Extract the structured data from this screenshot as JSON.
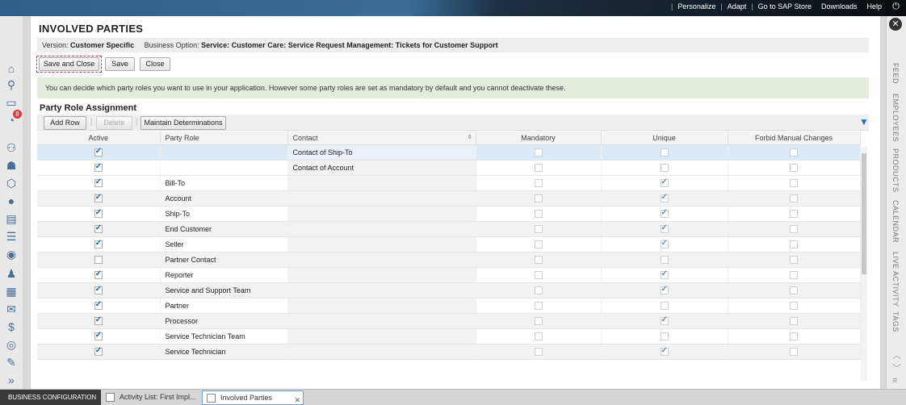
{
  "topbar": {
    "links": [
      "Personalize",
      "Adapt",
      "Go to SAP Store",
      "Downloads",
      "Help"
    ]
  },
  "left_rail": {
    "icons": [
      "home-icon",
      "search-icon",
      "chat-icon",
      "alert-icon",
      "org-chart-icon",
      "hierarchy-icon",
      "package-icon",
      "circle-icon",
      "report-icon",
      "list-icon",
      "person-icon",
      "people-list-icon",
      "building-icon",
      "mail-icon",
      "login-dollar-icon",
      "coin-icon",
      "user-edit-icon",
      "expand-icon"
    ],
    "alert_count": "8"
  },
  "right_rail": {
    "items": [
      "FEED",
      "EMPLOYEES",
      "PRODUCTS",
      "CALENDAR",
      "LIVE ACTIVITY",
      "TAGS"
    ]
  },
  "main": {
    "title": "INVOLVED PARTIES",
    "info": {
      "version_label": "Version:",
      "version_value": "Customer Specific",
      "option_label": "Business Option:",
      "option_value": "Service: Customer Care: Service Request Management: Tickets for Customer Support"
    },
    "buttons": {
      "save_close": "Save and Close",
      "save": "Save",
      "close": "Close"
    },
    "notice": "You can decide which party roles you want to use in your application. However some party roles are set as mandatory by default and you cannot deactivate these.",
    "section_title": "Party Role Assignment",
    "toolbar": {
      "add_row": "Add Row",
      "delete": "Delete",
      "maintain": "Maintain Determinations"
    },
    "table": {
      "headers": [
        "Active",
        "Party Role",
        "Contact",
        "Mandatory",
        "Unique",
        "Forbid Manual Changes"
      ],
      "rows": [
        {
          "active": true,
          "role": "",
          "contact": "Contact of Ship-To",
          "mandatory": false,
          "unique": false,
          "forbid": false,
          "selected": true
        },
        {
          "active": true,
          "role": "",
          "contact": "Contact of Account",
          "mandatory": false,
          "unique": false,
          "forbid": false
        },
        {
          "active": true,
          "role": "Bill-To",
          "contact": "",
          "mandatory": false,
          "unique": true,
          "forbid": false
        },
        {
          "active": true,
          "role": "Account",
          "contact": "",
          "mandatory": false,
          "unique": true,
          "forbid": false
        },
        {
          "active": true,
          "role": "Ship-To",
          "contact": "",
          "mandatory": false,
          "unique": true,
          "forbid": false
        },
        {
          "active": true,
          "role": "End Customer",
          "contact": "",
          "mandatory": false,
          "unique": true,
          "forbid": false
        },
        {
          "active": true,
          "role": "Seller",
          "contact": "",
          "mandatory": false,
          "unique": true,
          "forbid": false
        },
        {
          "active": false,
          "role": "Partner Contact",
          "contact": "",
          "mandatory": false,
          "unique": false,
          "forbid": false
        },
        {
          "active": true,
          "role": "Reporter",
          "contact": "",
          "mandatory": false,
          "unique": true,
          "forbid": false
        },
        {
          "active": true,
          "role": "Service and Support Team",
          "contact": "",
          "mandatory": false,
          "unique": true,
          "forbid": false
        },
        {
          "active": true,
          "role": "Partner",
          "contact": "",
          "mandatory": false,
          "unique": false,
          "forbid": false
        },
        {
          "active": true,
          "role": "Processor",
          "contact": "",
          "mandatory": false,
          "unique": true,
          "forbid": false
        },
        {
          "active": true,
          "role": "Service Technician Team",
          "contact": "",
          "mandatory": false,
          "unique": false,
          "forbid": false
        },
        {
          "active": true,
          "role": "Service Technician",
          "contact": "",
          "mandatory": false,
          "unique": true,
          "forbid": false
        }
      ]
    }
  },
  "bottom": {
    "business_config": "BUSINESS CONFIGURATION",
    "tabs": [
      "Activity List: First Impl...",
      "Involved Parties"
    ]
  }
}
